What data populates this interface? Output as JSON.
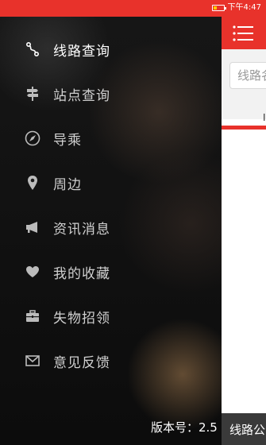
{
  "status": {
    "time": "下午4:47"
  },
  "drawer": {
    "items": [
      {
        "label": "线路查询",
        "icon": "route-icon",
        "active": true
      },
      {
        "label": "站点查询",
        "icon": "signpost-icon",
        "active": false
      },
      {
        "label": "导乘",
        "icon": "compass-icon",
        "active": false
      },
      {
        "label": "周边",
        "icon": "location-pin-icon",
        "active": false
      },
      {
        "label": "资讯消息",
        "icon": "megaphone-icon",
        "active": false
      },
      {
        "label": "我的收藏",
        "icon": "heart-icon",
        "active": false
      },
      {
        "label": "失物招领",
        "icon": "briefcase-icon",
        "active": false
      },
      {
        "label": "意见反馈",
        "icon": "envelope-icon",
        "active": false
      }
    ],
    "version": "版本号：2.5"
  },
  "main": {
    "search_placeholder": "线路名称",
    "tab_fragment": "I",
    "bottom_text": "线路公"
  },
  "colors": {
    "accent": "#e8322b"
  }
}
